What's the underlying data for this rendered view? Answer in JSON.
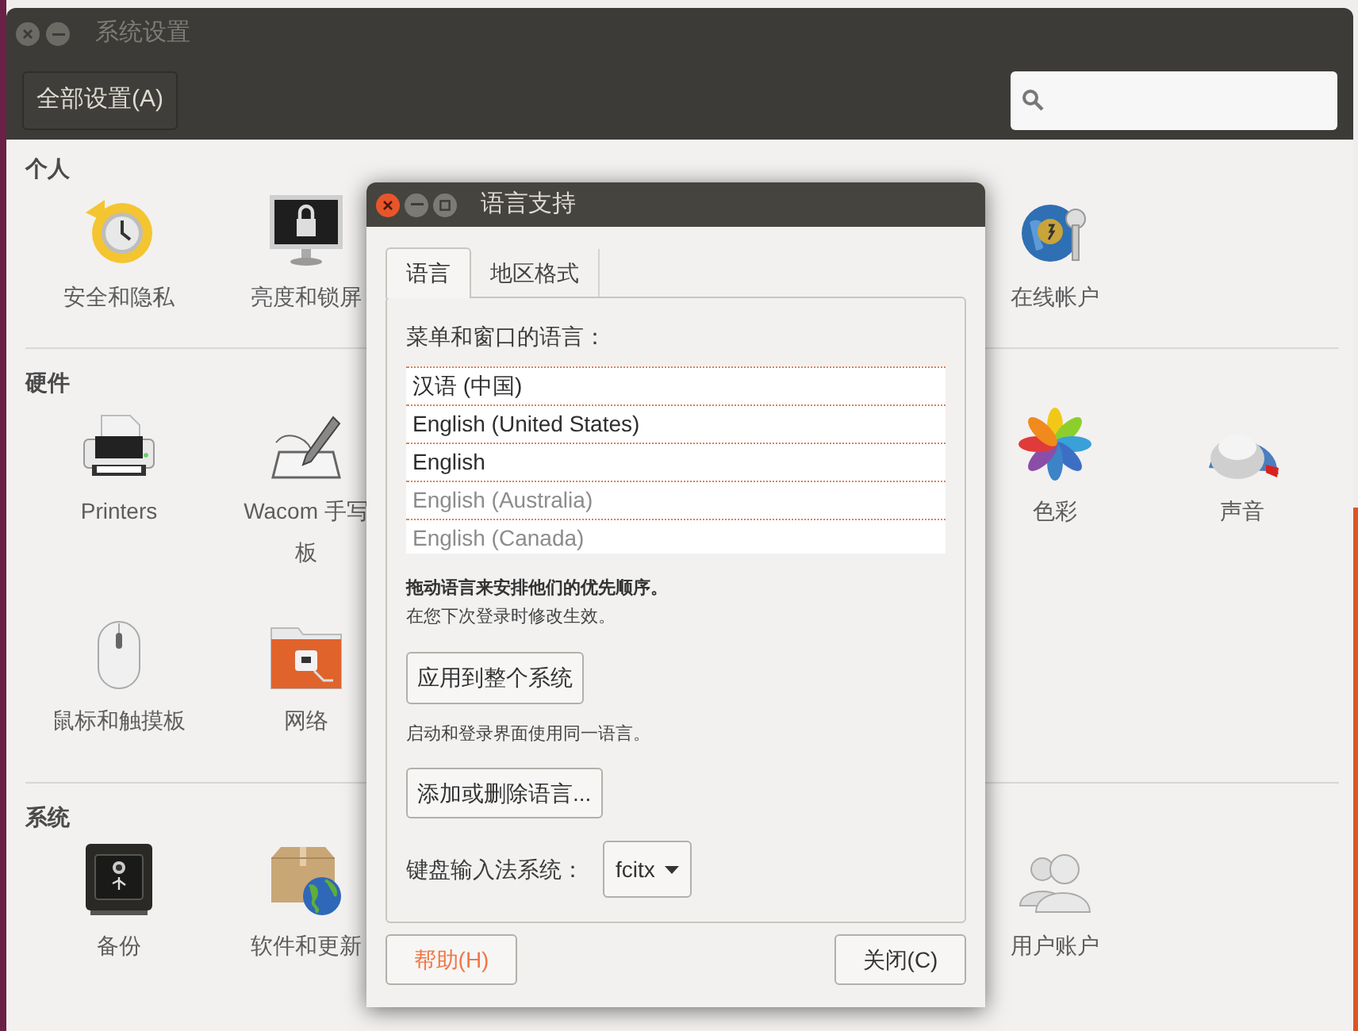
{
  "window": {
    "title": "系统设置",
    "toolbar_button": "全部设置(A)"
  },
  "sections": [
    {
      "title": "个人",
      "left_items": [
        {
          "label": "安全和隐私"
        },
        {
          "label": "亮度和锁屏"
        }
      ],
      "right_items": [
        {
          "label": "在线帐户"
        }
      ]
    },
    {
      "title": "硬件",
      "left_items": [
        {
          "label": "Printers"
        },
        {
          "label": "Wacom 手写板"
        },
        {
          "label": "鼠标和触摸板"
        },
        {
          "label": "网络"
        }
      ],
      "right_items": [
        {
          "label": "色彩"
        },
        {
          "label": "声音"
        }
      ]
    },
    {
      "title": "系统",
      "left_items": [
        {
          "label": "备份"
        },
        {
          "label": "软件和更新"
        }
      ],
      "right_items": [
        {
          "label": "用户账户"
        }
      ]
    }
  ],
  "dialog": {
    "title": "语言支持",
    "tabs": [
      {
        "label": "语言",
        "selected": true
      },
      {
        "label": "地区格式",
        "selected": false
      }
    ],
    "list_label": "菜单和窗口的语言：",
    "languages": [
      {
        "name": "汉语 (中国)",
        "active": true
      },
      {
        "name": "English (United States)",
        "active": true
      },
      {
        "name": "English",
        "active": true
      },
      {
        "name": "English (Australia)",
        "active": false
      },
      {
        "name": "English (Canada)",
        "active": false
      }
    ],
    "drag_hint": "拖动语言来安排他们的优先顺序。",
    "login_note": "在您下次登录时修改生效。",
    "apply_button": "应用到整个系统",
    "apply_note": "启动和登录界面使用同一语言。",
    "add_remove_button": "添加或删除语言...",
    "input_method_label": "键盘输入法系统：",
    "input_method_value": "fcitx",
    "help_button": "帮助(H)",
    "close_button": "关闭(C)"
  }
}
